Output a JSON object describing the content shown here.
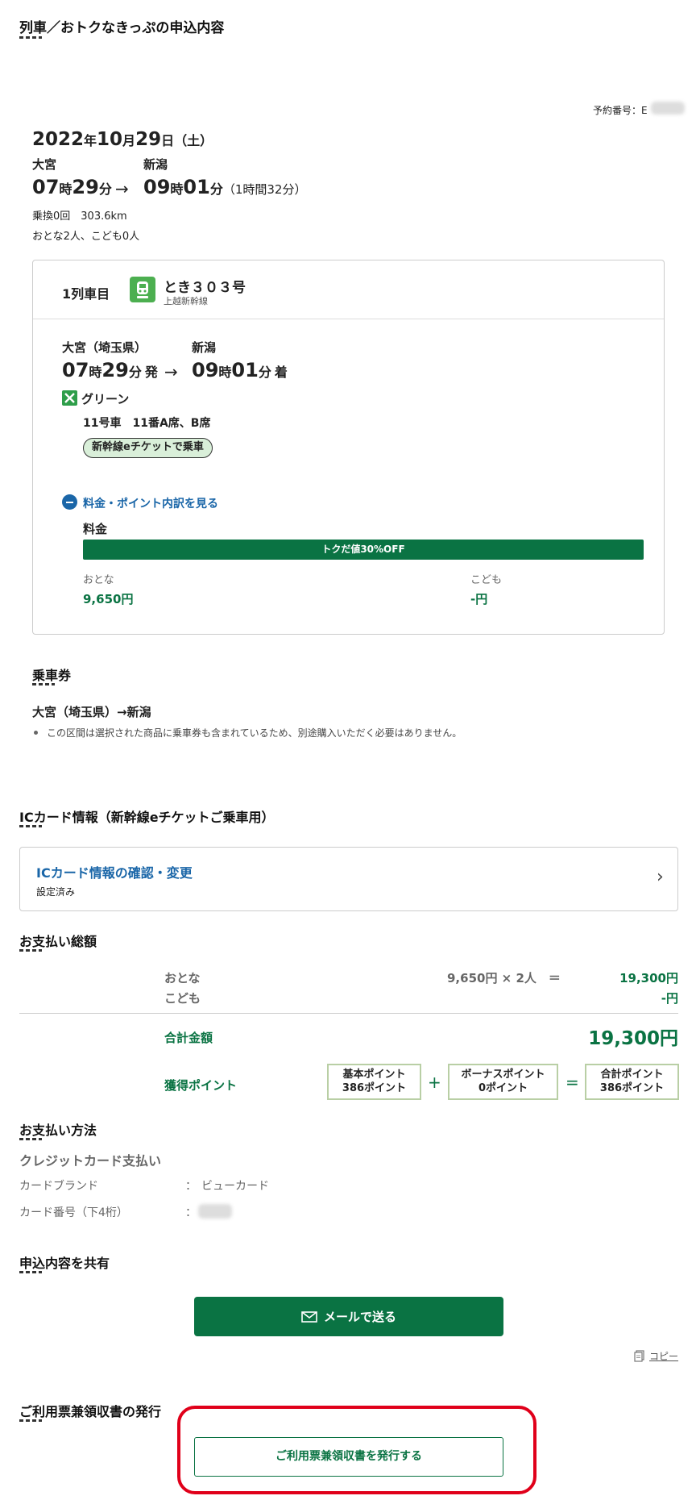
{
  "page_title": "列車／おトクなきっぷの申込内容",
  "reservation": {
    "label": "予約番号：E"
  },
  "trip": {
    "date_year": "2022",
    "date_year_unit": "年",
    "date_month": "10",
    "date_month_unit": "月",
    "date_day": "29",
    "date_day_unit": "日",
    "date_weekday": "（土）",
    "from": "大宮",
    "to": "新潟",
    "dep_hour": "07",
    "dep_hour_unit": "時",
    "dep_min": "29",
    "dep_min_unit": "分",
    "arrow": "→",
    "arr_hour": "09",
    "arr_hour_unit": "時",
    "arr_min": "01",
    "arr_min_unit": "分",
    "duration": "（1時間32分）",
    "transfers": "乗換0回　303.6km",
    "passengers": "おとな2人、こども0人"
  },
  "train_card": {
    "car_label": "1列車目",
    "train_name": "とき３０３号",
    "line_name": "上越新幹線",
    "from": "大宮（埼玉県）",
    "to": "新潟",
    "dep_hour": "07",
    "dep_min": "29",
    "dep_suffix": "発",
    "arr_hour": "09",
    "arr_min": "01",
    "arr_suffix": "着",
    "hour_unit": "時",
    "min_unit": "分",
    "class_name": "グリーン",
    "seat": "11号車　11番A席、B席",
    "eticket_badge": "新幹線eチケットで乗車",
    "fare_toggle": "料金・ポイント内訳を見る",
    "fare_heading": "料金",
    "discount_bar": "トクだ値30%OFF",
    "adult_label": "おとな",
    "adult_price": "9,650円",
    "child_label": "こども",
    "child_price": "-円"
  },
  "joshaken": {
    "heading": "乗車券",
    "route": "大宮（埼玉県）→新潟",
    "note": "この区間は選択された商品に乗車券も含まれているため、別途購入いただく必要はありません。"
  },
  "ic_card": {
    "heading": "ICカード情報（新幹線eチケットご乗車用）",
    "link_title": "ICカード情報の確認・変更",
    "status": "設定済み",
    "chevron": "›"
  },
  "payment_total": {
    "heading": "お支払い総額",
    "adult_label": "おとな",
    "adult_calc": "9,650円 × 2人　＝",
    "adult_total": "19,300円",
    "child_label": "こども",
    "child_total": "-円",
    "total_label": "合計金額",
    "total_value": "19,300円",
    "points_label": "獲得ポイント",
    "basic_label": "基本ポイント",
    "basic_value": "386ポイント",
    "plus": "+",
    "bonus_label": "ボーナスポイント",
    "bonus_value": "0ポイント",
    "equals": "=",
    "sum_label": "合計ポイント",
    "sum_value": "386ポイント"
  },
  "payment_method": {
    "heading": "お支払い方法",
    "method": "クレジットカード支払い",
    "brand_label": "カードブランド",
    "colon": "：",
    "brand_value": "ビューカード",
    "number_label": "カード番号（下4桁）"
  },
  "share": {
    "heading": "申込内容を共有",
    "mail_button": "メールで送る",
    "copy_link": "コピー"
  },
  "receipt": {
    "heading": "ご利用票兼領収書の発行",
    "button": "ご利用票兼領収書を発行する"
  },
  "colors": {
    "accent": "#0a7343",
    "link": "#1a66a8",
    "highlight": "#e0001a",
    "badge_bg": "#d9efd9"
  }
}
